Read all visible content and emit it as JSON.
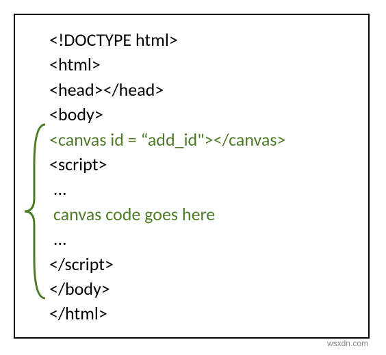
{
  "code": {
    "line1": "<!DOCTYPE html>",
    "line2": "<html>",
    "line3": "<head></head>",
    "line4": "<body>",
    "line5": "<canvas id = “add_id\"></canvas>",
    "line6": "<script>",
    "line7": " ...",
    "line8": " canvas code goes here",
    "line9": " ...",
    "line10": "</script>",
    "line11": "</body>",
    "line12": "</html>"
  },
  "watermark": "wsxdn.com"
}
